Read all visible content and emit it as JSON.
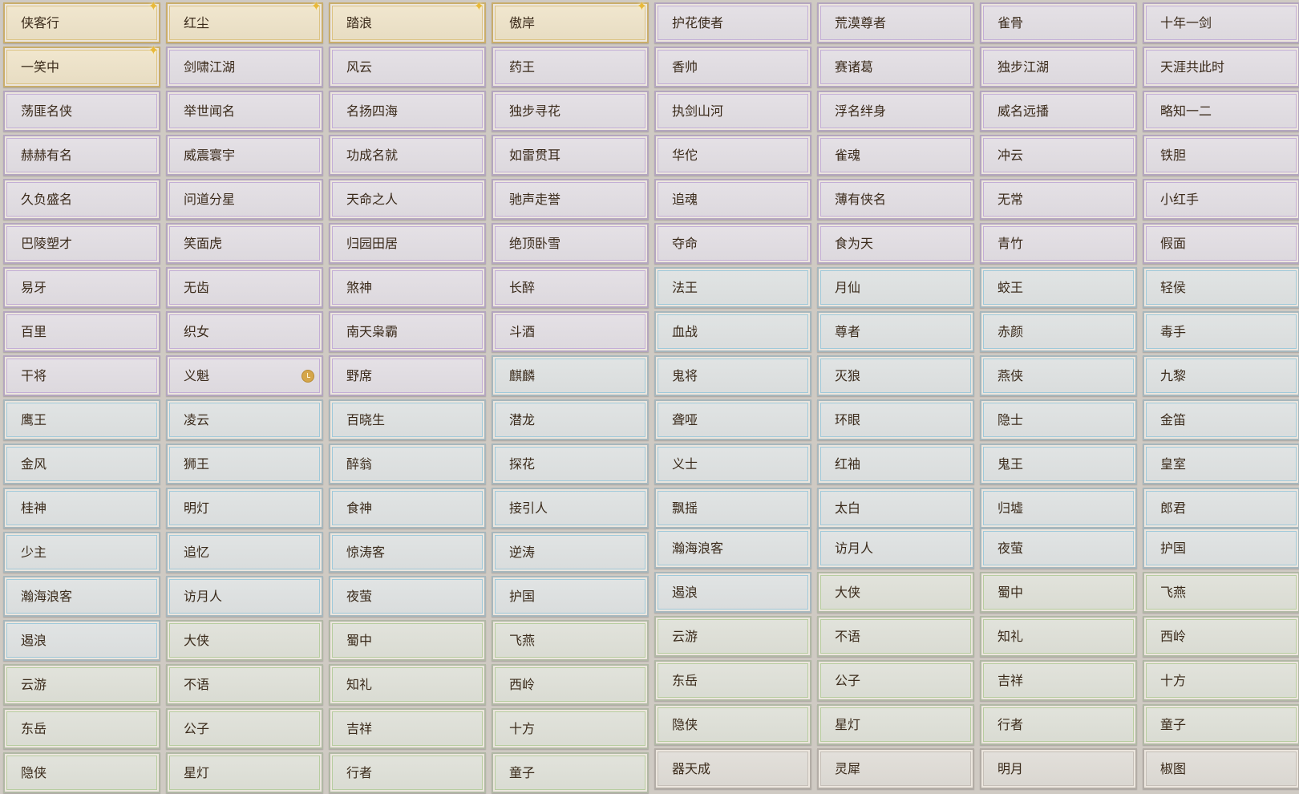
{
  "left_grid": [
    {
      "label": "侠客行",
      "tier": "gold",
      "sparkle": true
    },
    {
      "label": "红尘",
      "tier": "gold",
      "sparkle": true
    },
    {
      "label": "踏浪",
      "tier": "gold",
      "sparkle": true
    },
    {
      "label": "傲岸",
      "tier": "gold",
      "sparkle": true
    },
    {
      "label": "一笑中",
      "tier": "gold",
      "sparkle": true
    },
    {
      "label": "剑啸江湖",
      "tier": "purple"
    },
    {
      "label": "风云",
      "tier": "purple"
    },
    {
      "label": "药王",
      "tier": "purple"
    },
    {
      "label": "荡匪名侠",
      "tier": "purple"
    },
    {
      "label": "举世闻名",
      "tier": "purple"
    },
    {
      "label": "名扬四海",
      "tier": "purple"
    },
    {
      "label": "独步寻花",
      "tier": "purple"
    },
    {
      "label": "赫赫有名",
      "tier": "purple"
    },
    {
      "label": "威震寰宇",
      "tier": "purple"
    },
    {
      "label": "功成名就",
      "tier": "purple"
    },
    {
      "label": "如雷贯耳",
      "tier": "purple"
    },
    {
      "label": "久负盛名",
      "tier": "purple"
    },
    {
      "label": "问道分星",
      "tier": "purple"
    },
    {
      "label": "天命之人",
      "tier": "purple"
    },
    {
      "label": "驰声走誉",
      "tier": "purple"
    },
    {
      "label": "巴陵塑才",
      "tier": "purple"
    },
    {
      "label": "笑面虎",
      "tier": "purple"
    },
    {
      "label": "归园田居",
      "tier": "purple"
    },
    {
      "label": "绝顶卧雪",
      "tier": "purple"
    },
    {
      "label": "易牙",
      "tier": "purple"
    },
    {
      "label": "无齿",
      "tier": "purple"
    },
    {
      "label": "煞神",
      "tier": "purple"
    },
    {
      "label": "长醉",
      "tier": "purple"
    },
    {
      "label": "百里",
      "tier": "purple"
    },
    {
      "label": "织女",
      "tier": "purple"
    },
    {
      "label": "南天枭霸",
      "tier": "purple"
    },
    {
      "label": "斗酒",
      "tier": "purple"
    },
    {
      "label": "干将",
      "tier": "purple"
    },
    {
      "label": "义魁",
      "tier": "purple",
      "clock": true
    },
    {
      "label": "野席",
      "tier": "purple"
    },
    {
      "label": "麒麟",
      "tier": "blue"
    },
    {
      "label": "鹰王",
      "tier": "blue"
    },
    {
      "label": "凌云",
      "tier": "blue"
    },
    {
      "label": "百晓生",
      "tier": "blue"
    },
    {
      "label": "潜龙",
      "tier": "blue"
    },
    {
      "label": "金风",
      "tier": "blue"
    },
    {
      "label": "狮王",
      "tier": "blue"
    },
    {
      "label": "醉翁",
      "tier": "blue"
    },
    {
      "label": "探花",
      "tier": "blue"
    },
    {
      "label": "桂神",
      "tier": "blue"
    },
    {
      "label": "明灯",
      "tier": "blue"
    },
    {
      "label": "食神",
      "tier": "blue"
    },
    {
      "label": "接引人",
      "tier": "blue"
    },
    {
      "label": "少主",
      "tier": "blue"
    },
    {
      "label": "追忆",
      "tier": "blue"
    },
    {
      "label": "惊涛客",
      "tier": "blue"
    },
    {
      "label": "逆涛",
      "tier": "blue"
    },
    {
      "label": "瀚海浪客",
      "tier": "blue"
    },
    {
      "label": "访月人",
      "tier": "blue"
    },
    {
      "label": "夜萤",
      "tier": "blue"
    },
    {
      "label": "护国",
      "tier": "blue"
    },
    {
      "label": "遏浪",
      "tier": "blue"
    },
    {
      "label": "大侠",
      "tier": "green"
    },
    {
      "label": "蜀中",
      "tier": "green"
    },
    {
      "label": "飞燕",
      "tier": "green"
    },
    {
      "label": "云游",
      "tier": "green"
    },
    {
      "label": "不语",
      "tier": "green"
    },
    {
      "label": "知礼",
      "tier": "green"
    },
    {
      "label": "西岭",
      "tier": "green"
    },
    {
      "label": "东岳",
      "tier": "green"
    },
    {
      "label": "公子",
      "tier": "green"
    },
    {
      "label": "吉祥",
      "tier": "green"
    },
    {
      "label": "十方",
      "tier": "green"
    },
    {
      "label": "隐侠",
      "tier": "green"
    },
    {
      "label": "星灯",
      "tier": "green"
    },
    {
      "label": "行者",
      "tier": "green"
    },
    {
      "label": "童子",
      "tier": "green"
    }
  ],
  "right_grid": [
    {
      "label": "护花使者",
      "tier": "purple"
    },
    {
      "label": "荒漠尊者",
      "tier": "purple"
    },
    {
      "label": "雀骨",
      "tier": "purple"
    },
    {
      "label": "十年一剑",
      "tier": "purple"
    },
    {
      "label": "香帅",
      "tier": "purple"
    },
    {
      "label": "赛诸葛",
      "tier": "purple"
    },
    {
      "label": "独步江湖",
      "tier": "purple"
    },
    {
      "label": "天涯共此时",
      "tier": "purple"
    },
    {
      "label": "执剑山河",
      "tier": "purple"
    },
    {
      "label": "浮名绊身",
      "tier": "purple"
    },
    {
      "label": "威名远播",
      "tier": "purple"
    },
    {
      "label": "略知一二",
      "tier": "purple"
    },
    {
      "label": "华佗",
      "tier": "purple"
    },
    {
      "label": "雀魂",
      "tier": "purple"
    },
    {
      "label": "冲云",
      "tier": "purple"
    },
    {
      "label": "铁胆",
      "tier": "purple"
    },
    {
      "label": "追魂",
      "tier": "purple"
    },
    {
      "label": "薄有侠名",
      "tier": "purple"
    },
    {
      "label": "无常",
      "tier": "purple"
    },
    {
      "label": "小红手",
      "tier": "purple"
    },
    {
      "label": "夺命",
      "tier": "purple"
    },
    {
      "label": "食为天",
      "tier": "purple"
    },
    {
      "label": "青竹",
      "tier": "purple"
    },
    {
      "label": "假面",
      "tier": "purple"
    },
    {
      "label": "法王",
      "tier": "blue"
    },
    {
      "label": "月仙",
      "tier": "blue"
    },
    {
      "label": "蛟王",
      "tier": "blue"
    },
    {
      "label": "轻侯",
      "tier": "blue"
    },
    {
      "label": "血战",
      "tier": "blue"
    },
    {
      "label": "尊者",
      "tier": "blue"
    },
    {
      "label": "赤颜",
      "tier": "blue"
    },
    {
      "label": "毒手",
      "tier": "blue"
    },
    {
      "label": "鬼将",
      "tier": "blue"
    },
    {
      "label": "灭狼",
      "tier": "blue"
    },
    {
      "label": "燕侠",
      "tier": "blue"
    },
    {
      "label": "九黎",
      "tier": "blue"
    },
    {
      "label": "聋哑",
      "tier": "blue"
    },
    {
      "label": "环眼",
      "tier": "blue"
    },
    {
      "label": "隐士",
      "tier": "blue"
    },
    {
      "label": "金笛",
      "tier": "blue"
    },
    {
      "label": "义士",
      "tier": "blue"
    },
    {
      "label": "红袖",
      "tier": "blue"
    },
    {
      "label": "鬼王",
      "tier": "blue"
    },
    {
      "label": "皇室",
      "tier": "blue"
    },
    {
      "label": "飘摇",
      "tier": "blue"
    },
    {
      "label": "太白",
      "tier": "blue"
    },
    {
      "label": "归墟",
      "tier": "blue"
    },
    {
      "label": "郎君",
      "tier": "blue"
    },
    {
      "label": "瀚海浪客",
      "tier": "blue"
    },
    {
      "label": "访月人",
      "tier": "blue"
    },
    {
      "label": "夜萤",
      "tier": "blue"
    },
    {
      "label": "护国",
      "tier": "blue"
    },
    {
      "label": "遏浪",
      "tier": "blue"
    },
    {
      "label": "大侠",
      "tier": "green"
    },
    {
      "label": "蜀中",
      "tier": "green"
    },
    {
      "label": "飞燕",
      "tier": "green"
    },
    {
      "label": "云游",
      "tier": "green"
    },
    {
      "label": "不语",
      "tier": "green"
    },
    {
      "label": "知礼",
      "tier": "green"
    },
    {
      "label": "西岭",
      "tier": "green"
    },
    {
      "label": "东岳",
      "tier": "green"
    },
    {
      "label": "公子",
      "tier": "green"
    },
    {
      "label": "吉祥",
      "tier": "green"
    },
    {
      "label": "十方",
      "tier": "green"
    },
    {
      "label": "隐侠",
      "tier": "green"
    },
    {
      "label": "星灯",
      "tier": "green"
    },
    {
      "label": "行者",
      "tier": "green"
    },
    {
      "label": "童子",
      "tier": "green"
    },
    {
      "label": "器天成",
      "tier": "grey"
    },
    {
      "label": "灵犀",
      "tier": "grey"
    },
    {
      "label": "明月",
      "tier": "grey"
    },
    {
      "label": "椒图",
      "tier": "grey"
    }
  ],
  "icons": {
    "new_badge": "sparkle-icon",
    "timer_badge": "clock-icon"
  },
  "tier_colors": {
    "gold": "#dcc383",
    "purple": "#c3aed6",
    "blue": "#9fc9da",
    "green": "#b7cda0",
    "grey": "#c5bfb8"
  }
}
